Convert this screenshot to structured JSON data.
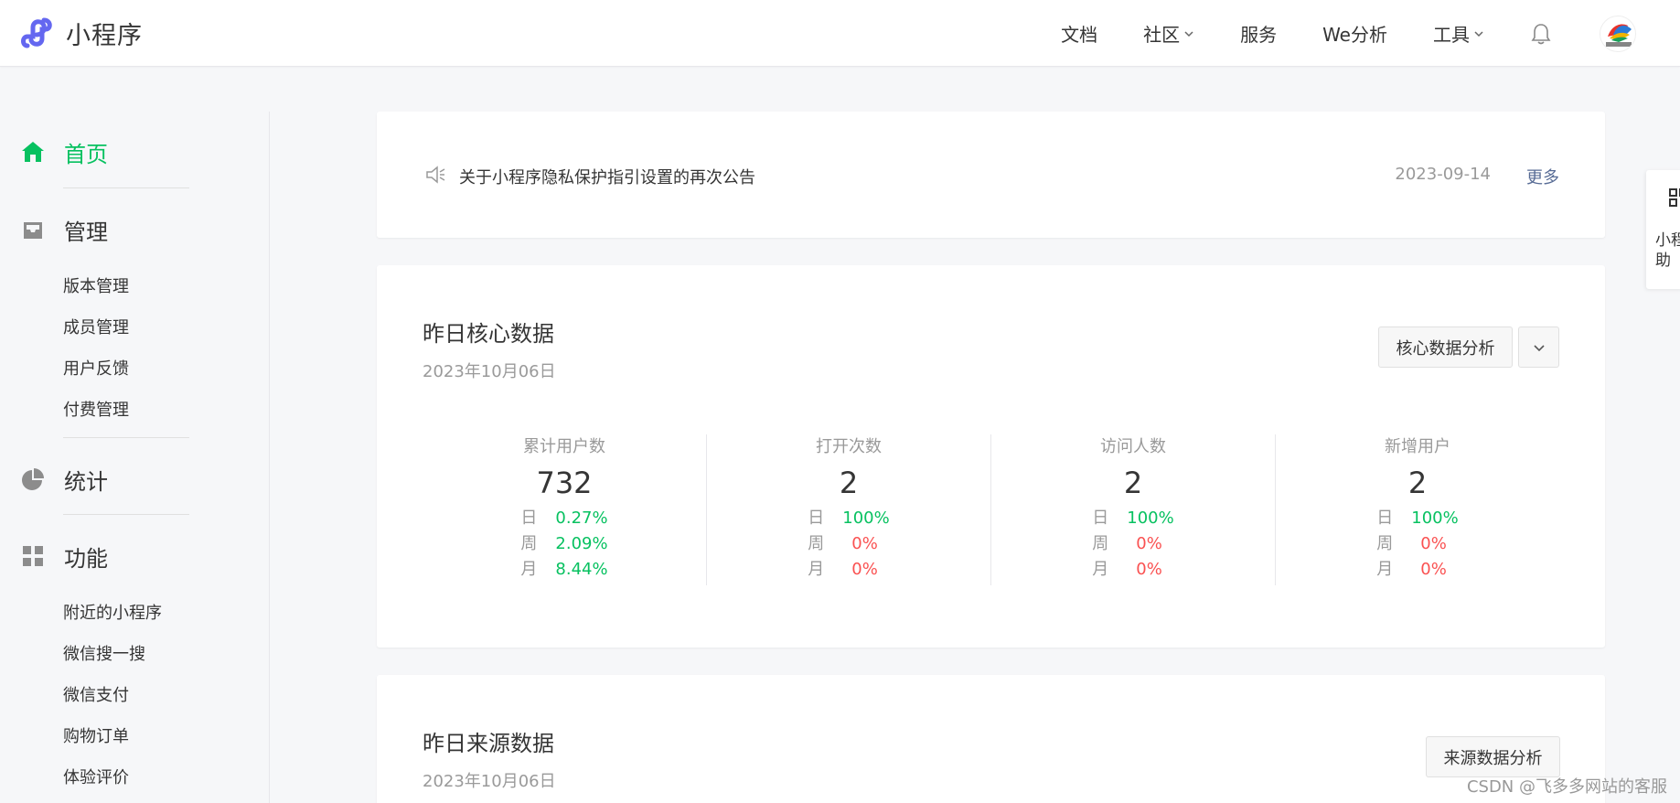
{
  "app": {
    "name": "小程序",
    "accent": "#07c160",
    "link_color": "#576b95",
    "down_color": "#fa5151"
  },
  "nav": [
    {
      "label": "文档",
      "dropdown": false
    },
    {
      "label": "社区",
      "dropdown": true
    },
    {
      "label": "服务",
      "dropdown": false
    },
    {
      "label": "We分析",
      "dropdown": false
    },
    {
      "label": "工具",
      "dropdown": true
    }
  ],
  "sidebar": {
    "home": "首页",
    "manage": {
      "title": "管理",
      "items": [
        "版本管理",
        "成员管理",
        "用户反馈",
        "付费管理"
      ]
    },
    "stats": "统计",
    "features": {
      "title": "功能",
      "items": [
        "附近的小程序",
        "微信搜一搜",
        "微信支付",
        "购物订单",
        "体验评价"
      ]
    }
  },
  "notice": {
    "text": "关于小程序隐私保护指引设置的再次公告",
    "date": "2023-09-14",
    "more": "更多"
  },
  "core": {
    "title": "昨日核心数据",
    "date": "2023年10月06日",
    "analysis_button": "核心数据分析",
    "stats": [
      {
        "label": "累计用户数",
        "value": "732",
        "rows": [
          {
            "k": "日",
            "v": "0.27%",
            "trend": "up"
          },
          {
            "k": "周",
            "v": "2.09%",
            "trend": "up"
          },
          {
            "k": "月",
            "v": "8.44%",
            "trend": "up"
          }
        ]
      },
      {
        "label": "打开次数",
        "value": "2",
        "rows": [
          {
            "k": "日",
            "v": "100%",
            "trend": "up"
          },
          {
            "k": "周",
            "v": "0%",
            "trend": "down"
          },
          {
            "k": "月",
            "v": "0%",
            "trend": "down"
          }
        ]
      },
      {
        "label": "访问人数",
        "value": "2",
        "rows": [
          {
            "k": "日",
            "v": "100%",
            "trend": "up"
          },
          {
            "k": "周",
            "v": "0%",
            "trend": "down"
          },
          {
            "k": "月",
            "v": "0%",
            "trend": "down"
          }
        ]
      },
      {
        "label": "新增用户",
        "value": "2",
        "rows": [
          {
            "k": "日",
            "v": "100%",
            "trend": "up"
          },
          {
            "k": "周",
            "v": "0%",
            "trend": "down"
          },
          {
            "k": "月",
            "v": "0%",
            "trend": "down"
          }
        ]
      }
    ]
  },
  "source": {
    "title": "昨日来源数据",
    "date": "2023年10月06日",
    "analysis_button": "来源数据分析"
  },
  "helper": {
    "text": "小程\n助"
  },
  "watermark": "CSDN @飞多多网站的客服"
}
